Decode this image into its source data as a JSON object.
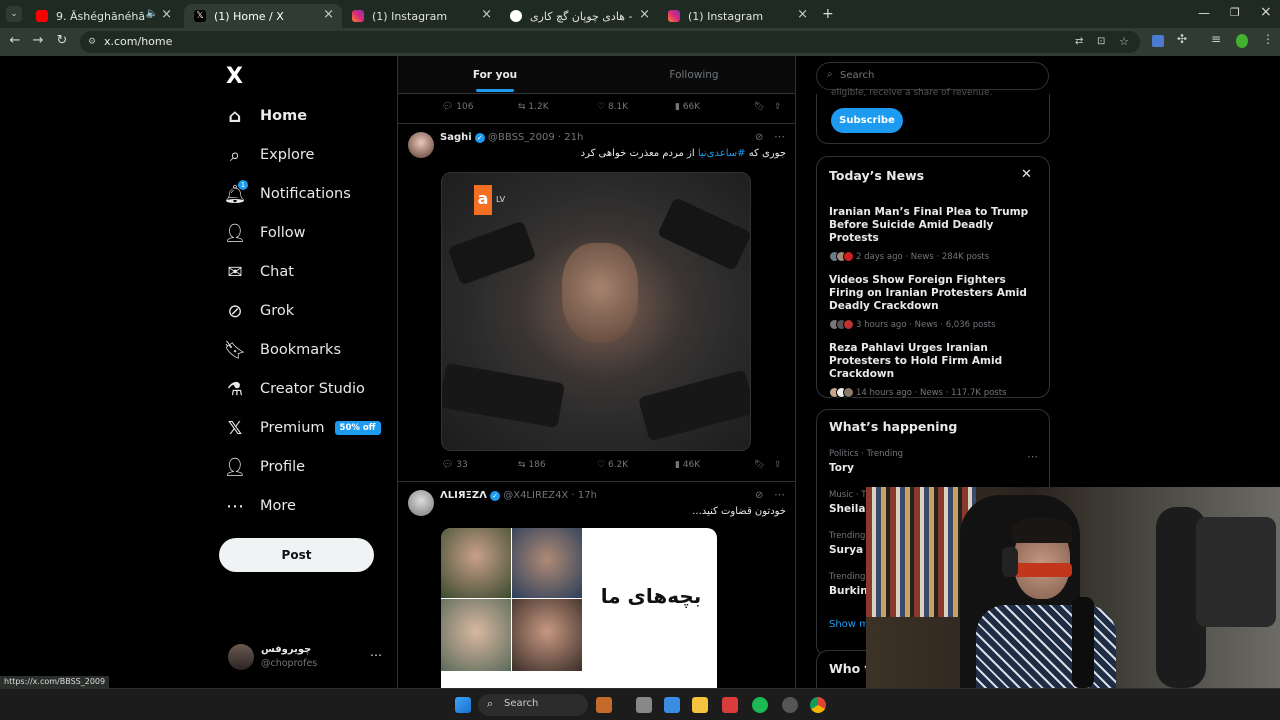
{
  "browser": {
    "tabs": [
      {
        "label": "9. Āshéghānéhā - عاشقانه‌ها",
        "color": "#ff0000"
      },
      {
        "label": "(1) Home / X",
        "color": "#ffffff"
      },
      {
        "label": "(1) Instagram",
        "color": "#e1306c"
      },
      {
        "label": "هادی چوپان گچ کاری - Search",
        "color": "#4285f4"
      },
      {
        "label": "(1) Instagram",
        "color": "#e1306c"
      }
    ],
    "url": "x.com/home",
    "status_url": "https://x.com/BBSS_2009"
  },
  "nav": {
    "logo": "X",
    "items": [
      {
        "label": "Home",
        "icon": "home-icon"
      },
      {
        "label": "Explore",
        "icon": "search-icon"
      },
      {
        "label": "Notifications",
        "icon": "bell-icon",
        "badge": "1"
      },
      {
        "label": "Follow",
        "icon": "person-add-icon"
      },
      {
        "label": "Chat",
        "icon": "mail-icon"
      },
      {
        "label": "Grok",
        "icon": "grok-icon"
      },
      {
        "label": "Bookmarks",
        "icon": "bookmark-icon"
      },
      {
        "label": "Creator Studio",
        "icon": "flask-icon"
      },
      {
        "label": "Premium",
        "icon": "x-premium-icon",
        "badge": "50% off"
      },
      {
        "label": "Profile",
        "icon": "person-icon"
      },
      {
        "label": "More",
        "icon": "more-circle-icon"
      }
    ],
    "post_label": "Post",
    "account": {
      "name": "چویروفس",
      "handle": "@choprofes"
    }
  },
  "feed": {
    "tabs": [
      "For you",
      "Following"
    ],
    "top_actions": {
      "replies": "106",
      "reposts": "1.2K",
      "likes": "8.1K",
      "views": "66K"
    },
    "posts": [
      {
        "name": "Saghi",
        "handle": "@BBSS_2009",
        "time": "21h",
        "text_plain": "جوری که ",
        "hashtag": "#ساعدی‌نیا",
        "text_rest": " از مردم معذرت خواهی کرد",
        "media_logo": "a",
        "media_logo_sub": "LV",
        "replies": "33",
        "reposts": "186",
        "likes": "6.2K",
        "views": "46K"
      },
      {
        "name": "ΛLIЯΞZΛ",
        "handle": "@X4LIREZ4X",
        "time": "17h",
        "text": "خودتون قضاوت کنید...",
        "media_caption": "بچه‌های ما"
      }
    ]
  },
  "right": {
    "search_placeholder": "Search",
    "promo_text": "eligible, receive a share of revenue.",
    "subscribe_label": "Subscribe",
    "news_title": "Today’s News",
    "news": [
      {
        "title": "Iranian Man’s Final Plea to Trump Before Suicide Amid Deadly Protests",
        "meta": "2 days ago · News · 284K posts"
      },
      {
        "title": "Videos Show Foreign Fighters Firing on Iranian Protesters Amid Deadly Crackdown",
        "meta": "3 hours ago · News · 6,036 posts"
      },
      {
        "title": "Reza Pahlavi Urges Iranian Protesters to Hold Firm Amid Crackdown",
        "meta": "14 hours ago · News · 117.7K posts"
      }
    ],
    "happening_title": "What’s happening",
    "trends": [
      {
        "category": "Politics · Trending",
        "name": "Tory"
      },
      {
        "category": "Music · Tr",
        "name": "Sheila"
      },
      {
        "category": "Trending i",
        "name": "Surya Bo"
      },
      {
        "category": "Trending i",
        "name": "Burkina"
      }
    ],
    "show_more": "Show mo",
    "who_to_follow": "Who t"
  },
  "taskbar": {
    "search_label": "Search"
  }
}
